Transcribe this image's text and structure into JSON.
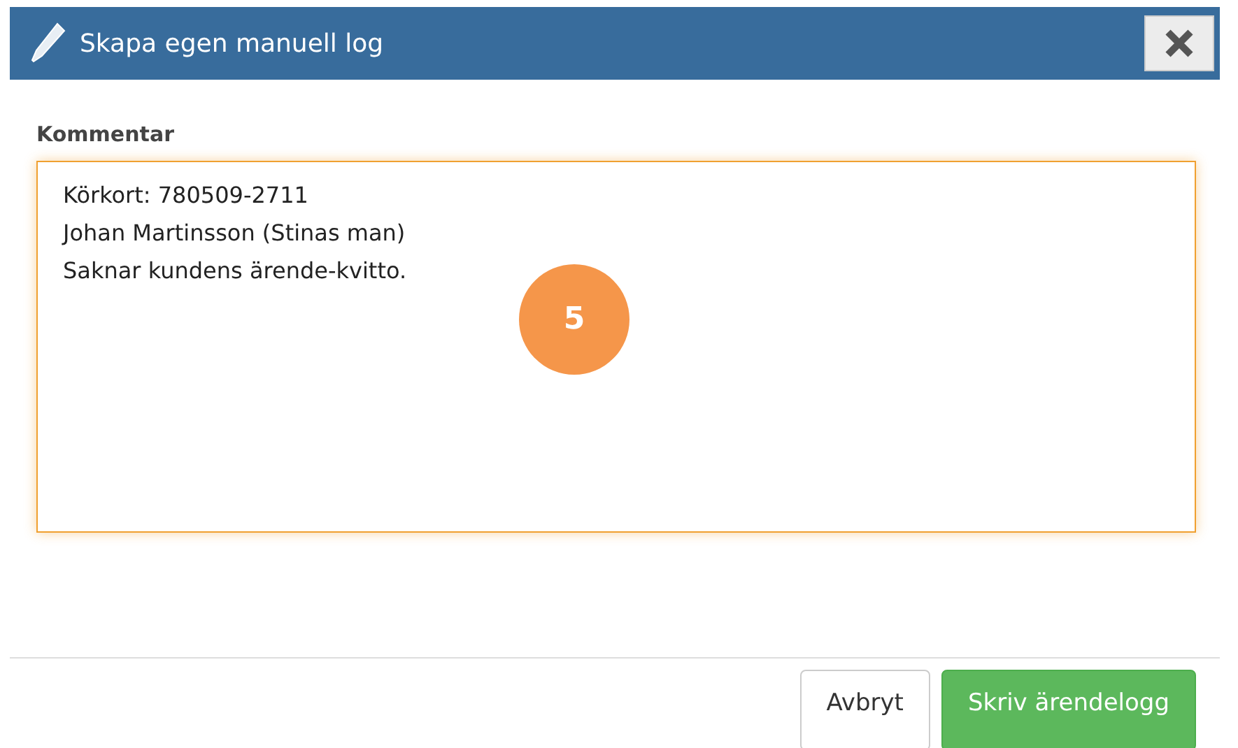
{
  "dialog": {
    "title": "Skapa egen manuell log"
  },
  "comment": {
    "label": "Kommentar",
    "focused": true,
    "lines": [
      "Körkort: 780509-2711",
      "Johan Martinsson (Stinas man)",
      "Saknar kundens ärende-kvitto."
    ]
  },
  "step_badge": "5",
  "buttons": [
    {
      "label": "Avbryt",
      "kind": "secondary"
    },
    {
      "label": "Skriv ärendelogg",
      "kind": "primary"
    }
  ]
}
